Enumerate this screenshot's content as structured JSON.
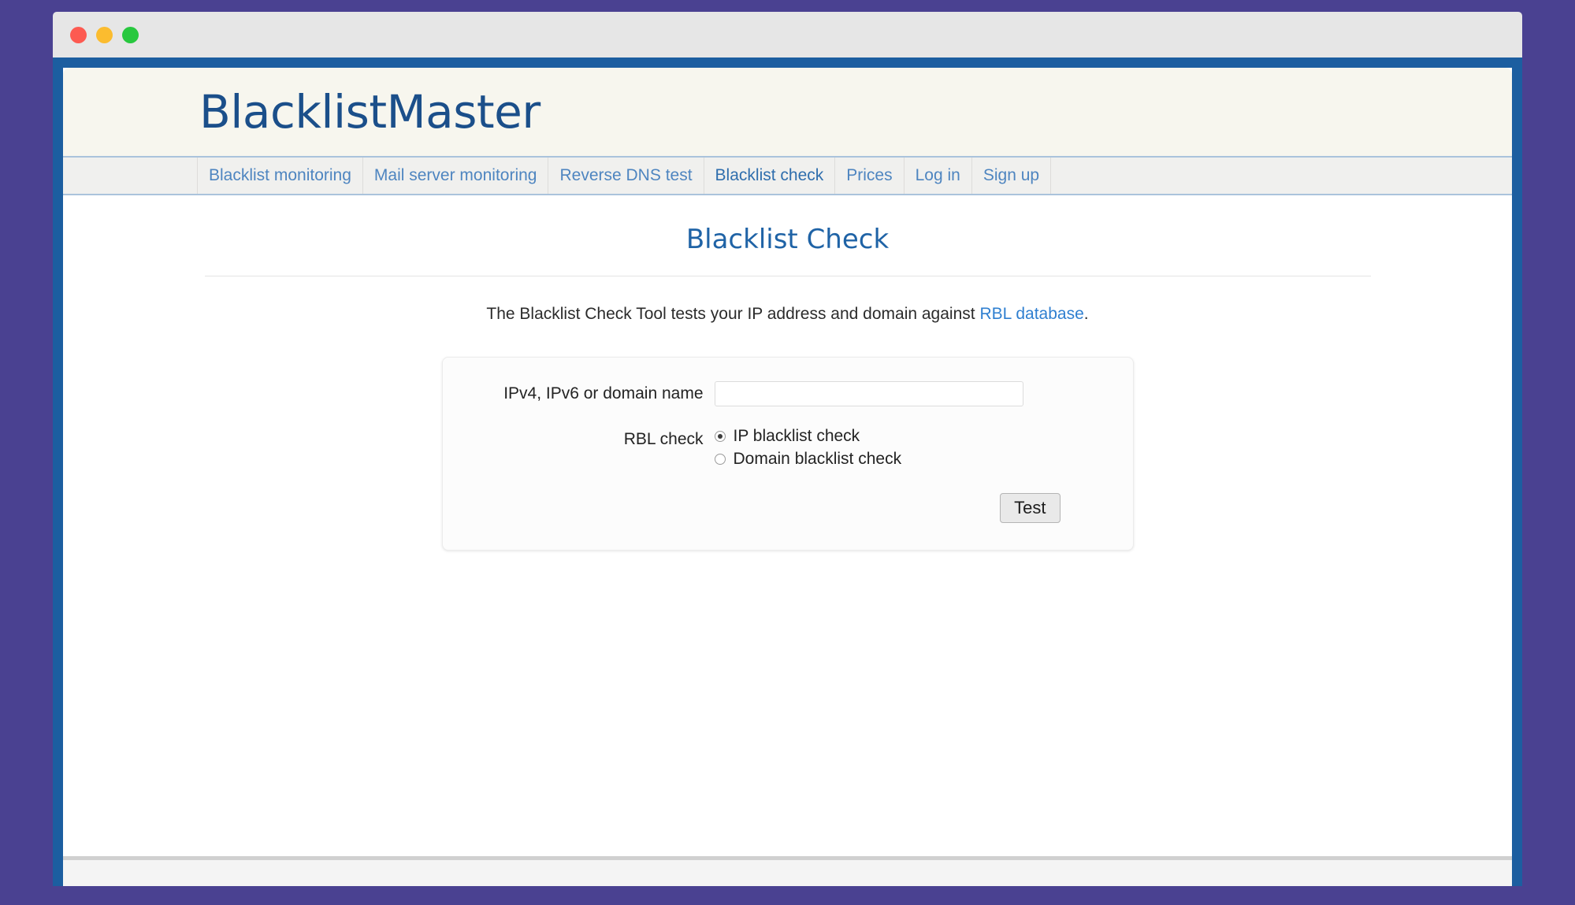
{
  "window": {
    "traffic_lights": [
      {
        "name": "close",
        "color": "#fd5a51"
      },
      {
        "name": "minimize",
        "color": "#fbbc2f"
      },
      {
        "name": "maximize",
        "color": "#28c83f"
      }
    ]
  },
  "brand": {
    "name": "BlacklistMaster"
  },
  "nav": {
    "items": [
      {
        "label": "Blacklist monitoring",
        "active": false
      },
      {
        "label": "Mail server monitoring",
        "active": false
      },
      {
        "label": "Reverse DNS test",
        "active": false
      },
      {
        "label": "Blacklist check",
        "active": true
      },
      {
        "label": "Prices",
        "active": false
      },
      {
        "label": "Log in",
        "active": false
      },
      {
        "label": "Sign up",
        "active": false
      }
    ]
  },
  "page": {
    "title": "Blacklist Check",
    "lead_prefix": "The Blacklist Check Tool tests your IP address and domain against ",
    "lead_link": "RBL database",
    "lead_suffix": "."
  },
  "form": {
    "host_label": "IPv4, IPv6 or domain name",
    "host_value": "",
    "host_placeholder": "",
    "rbl_label": "RBL check",
    "options": [
      {
        "label": "IP blacklist check",
        "selected": true
      },
      {
        "label": "Domain blacklist check",
        "selected": false
      }
    ],
    "submit_label": "Test"
  },
  "colors": {
    "desktop_background": "#4a4191",
    "browser_frame": "#1c5ea0",
    "titlebar": "#e6e6e6",
    "header_band": "#f7f6ee",
    "nav_band": "#f0f0ee",
    "brand_blue": "#1b4f8a",
    "link_blue": "#2f7fd0",
    "nav_link": "#4e85c0",
    "title_blue": "#1f63a6"
  }
}
